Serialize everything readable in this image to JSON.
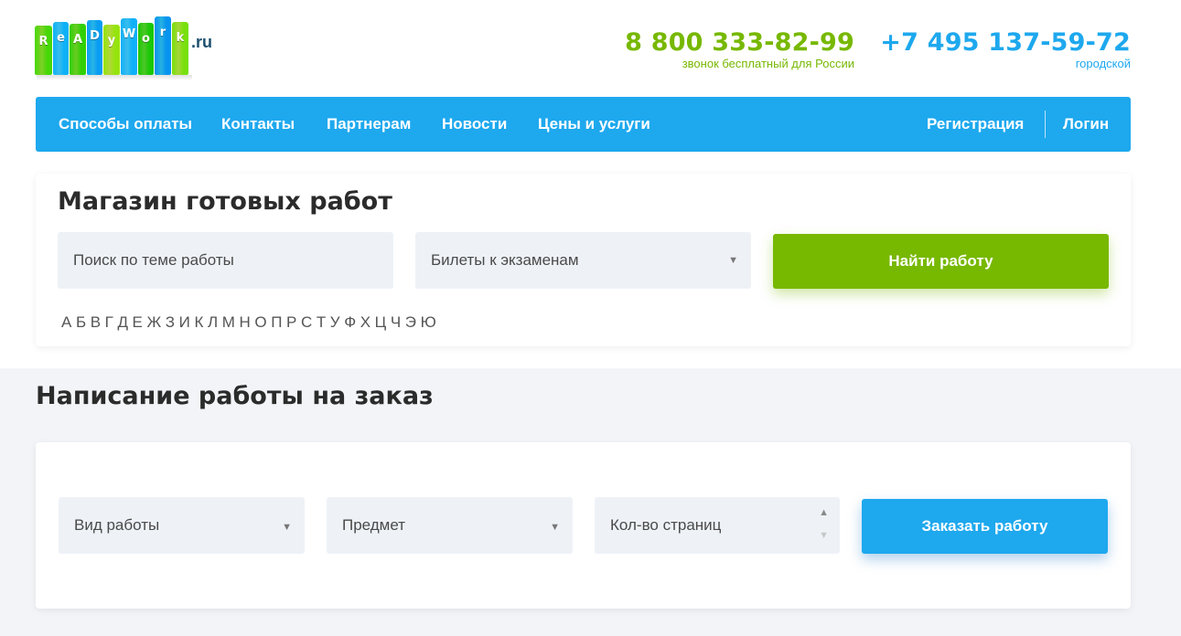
{
  "logo": {
    "letters": [
      "R",
      "e",
      "A",
      "D",
      "y",
      "W",
      "o",
      "r",
      "k"
    ],
    "domain": ".ru",
    "colors": [
      "#5fb81e",
      "#2a9be0",
      "#4fb21b",
      "#1f8fd8",
      "#8bc42a",
      "#2b9be3",
      "#3aab1e",
      "#1e8ad2",
      "#7cc02a"
    ]
  },
  "phones": {
    "free": {
      "number": "8 800 333-82-99",
      "caption": "звонок бесплатный для России",
      "color": "#77b800"
    },
    "city": {
      "number": "+7 495 137-59-72",
      "caption": "городской",
      "color": "#1ea8ee"
    }
  },
  "nav": {
    "items": [
      "Способы оплаты",
      "Контакты",
      "Партнерам",
      "Новости",
      "Цены и услуги"
    ],
    "register": "Регистрация",
    "login": "Логин",
    "color": "#1ea8ee"
  },
  "shop": {
    "title": "Магазин готовых работ",
    "search_placeholder": "Поиск по теме работы",
    "category_selected": "Билеты к экзаменам",
    "button": "Найти работу",
    "alphabet": [
      "А",
      "Б",
      "В",
      "Г",
      "Д",
      "Е",
      "Ж",
      "З",
      "И",
      "К",
      "Л",
      "М",
      "Н",
      "О",
      "П",
      "Р",
      "С",
      "Т",
      "У",
      "Ф",
      "Х",
      "Ц",
      "Ч",
      "Э",
      "Ю"
    ]
  },
  "order": {
    "title": "Написание работы на заказ",
    "work_type": "Вид работы",
    "subject": "Предмет",
    "pages_placeholder": "Кол-во страниц",
    "button": "Заказать работу"
  },
  "icons": {
    "select_caret": "triangle-down-icon",
    "spinner_up": "triangle-up-icon",
    "spinner_down": "triangle-down-icon"
  }
}
